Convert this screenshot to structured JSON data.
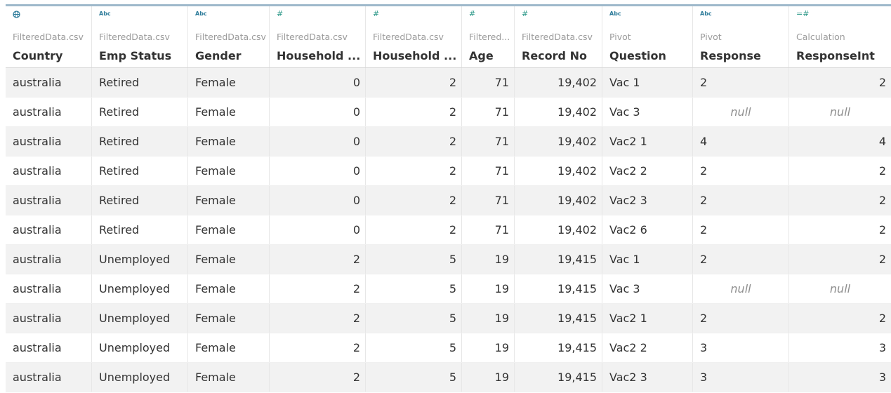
{
  "columns": [
    {
      "icon": "globe-icon",
      "type": "geo",
      "source": "FilteredData.csv",
      "name": "Country"
    },
    {
      "icon": "abc-icon",
      "type": "abc",
      "icon_text": "Abc",
      "source": "FilteredData.csv",
      "name": "Emp Status"
    },
    {
      "icon": "abc-icon",
      "type": "abc",
      "icon_text": "Abc",
      "source": "FilteredData.csv",
      "name": "Gender"
    },
    {
      "icon": "number-icon",
      "type": "num",
      "icon_text": "#",
      "source": "FilteredData.csv",
      "name": "Household ..."
    },
    {
      "icon": "number-icon",
      "type": "num",
      "icon_text": "#",
      "source": "FilteredData.csv",
      "name": "Household ..."
    },
    {
      "icon": "number-icon",
      "type": "num",
      "icon_text": "#",
      "source": "Filtered...",
      "name": "Age"
    },
    {
      "icon": "number-icon",
      "type": "num",
      "icon_text": "#",
      "source": "FilteredData.csv",
      "name": "Record No"
    },
    {
      "icon": "abc-icon",
      "type": "abc",
      "icon_text": "Abc",
      "source": "Pivot",
      "name": "Question"
    },
    {
      "icon": "abc-icon",
      "type": "abc",
      "icon_text": "Abc",
      "source": "Pivot",
      "name": "Response"
    },
    {
      "icon": "calculated-number-icon",
      "type": "num",
      "icon_text": "=#",
      "source": "Calculation",
      "name": "ResponseInt"
    }
  ],
  "null_label": "null",
  "rows": [
    [
      "australia",
      "Retired",
      "Female",
      "0",
      "2",
      "71",
      "19,402",
      "Vac 1",
      "2",
      "2"
    ],
    [
      "australia",
      "Retired",
      "Female",
      "0",
      "2",
      "71",
      "19,402",
      "Vac 3",
      "null",
      "null"
    ],
    [
      "australia",
      "Retired",
      "Female",
      "0",
      "2",
      "71",
      "19,402",
      "Vac2 1",
      "4",
      "4"
    ],
    [
      "australia",
      "Retired",
      "Female",
      "0",
      "2",
      "71",
      "19,402",
      "Vac2 2",
      "2",
      "2"
    ],
    [
      "australia",
      "Retired",
      "Female",
      "0",
      "2",
      "71",
      "19,402",
      "Vac2 3",
      "2",
      "2"
    ],
    [
      "australia",
      "Retired",
      "Female",
      "0",
      "2",
      "71",
      "19,402",
      "Vac2 6",
      "2",
      "2"
    ],
    [
      "australia",
      "Unemployed",
      "Female",
      "2",
      "5",
      "19",
      "19,415",
      "Vac 1",
      "2",
      "2"
    ],
    [
      "australia",
      "Unemployed",
      "Female",
      "2",
      "5",
      "19",
      "19,415",
      "Vac 3",
      "null",
      "null"
    ],
    [
      "australia",
      "Unemployed",
      "Female",
      "2",
      "5",
      "19",
      "19,415",
      "Vac2 1",
      "2",
      "2"
    ],
    [
      "australia",
      "Unemployed",
      "Female",
      "2",
      "5",
      "19",
      "19,415",
      "Vac2 2",
      "3",
      "3"
    ],
    [
      "australia",
      "Unemployed",
      "Female",
      "2",
      "5",
      "19",
      "19,415",
      "Vac2 3",
      "3",
      "3"
    ]
  ],
  "colors": {
    "header_accent": "#9fb9cb",
    "abc_icon": "#2c7b9a",
    "number_icon": "#2f9a8a",
    "stripe": "#f2f2f2"
  }
}
